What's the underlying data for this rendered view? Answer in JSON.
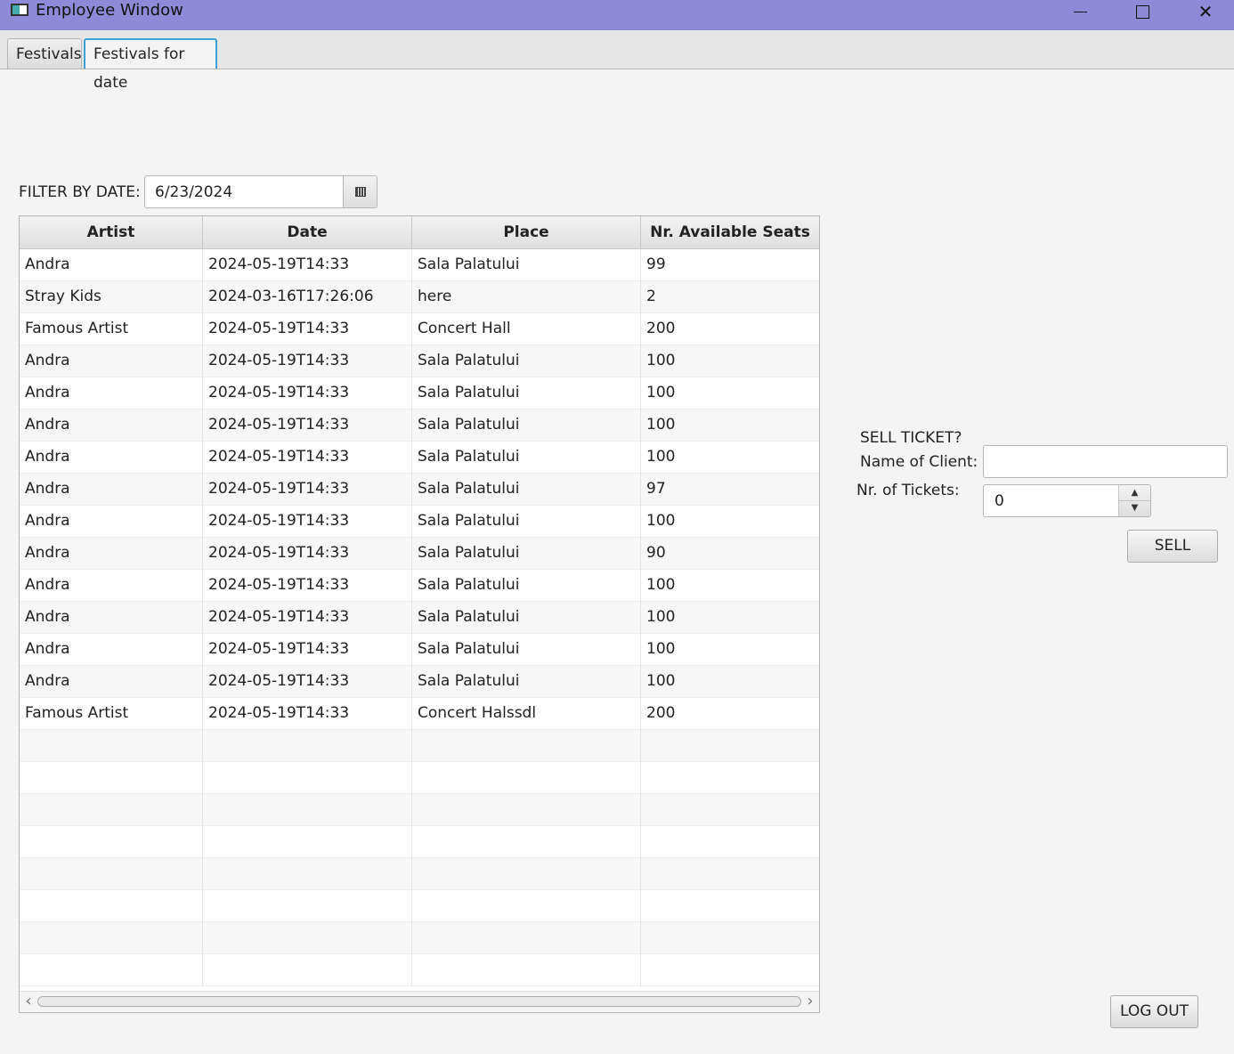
{
  "window": {
    "title": "Employee Window"
  },
  "tabs": [
    {
      "label": "Festivals"
    },
    {
      "label": "Festivals for date"
    }
  ],
  "filter": {
    "label": "FILTER BY DATE:",
    "date_value": "6/23/2024"
  },
  "table": {
    "headers": [
      "Artist",
      "Date",
      "Place",
      "Nr. Available Seats"
    ],
    "rows": [
      [
        "Andra",
        "2024-05-19T14:33",
        "Sala Palatului",
        "99"
      ],
      [
        "Stray Kids",
        "2024-03-16T17:26:06",
        "here",
        "2"
      ],
      [
        "Famous Artist",
        "2024-05-19T14:33",
        "Concert Hall",
        "200"
      ],
      [
        "Andra",
        "2024-05-19T14:33",
        "Sala Palatului",
        "100"
      ],
      [
        "Andra",
        "2024-05-19T14:33",
        "Sala Palatului",
        "100"
      ],
      [
        "Andra",
        "2024-05-19T14:33",
        "Sala Palatului",
        "100"
      ],
      [
        "Andra",
        "2024-05-19T14:33",
        "Sala Palatului",
        "100"
      ],
      [
        "Andra",
        "2024-05-19T14:33",
        "Sala Palatului",
        "97"
      ],
      [
        "Andra",
        "2024-05-19T14:33",
        "Sala Palatului",
        "100"
      ],
      [
        "Andra",
        "2024-05-19T14:33",
        "Sala Palatului",
        "90"
      ],
      [
        "Andra",
        "2024-05-19T14:33",
        "Sala Palatului",
        "100"
      ],
      [
        "Andra",
        "2024-05-19T14:33",
        "Sala Palatului",
        "100"
      ],
      [
        "Andra",
        "2024-05-19T14:33",
        "Sala Palatului",
        "100"
      ],
      [
        "Andra",
        "2024-05-19T14:33",
        "Sala Palatului",
        "100"
      ],
      [
        "Famous Artist",
        "2024-05-19T14:33",
        "Concert Halssdl",
        "200"
      ]
    ]
  },
  "sell": {
    "title": "SELL TICKET?",
    "client_label": "Name of Client:",
    "client_value": "",
    "tickets_label": "Nr. of Tickets:",
    "tickets_value": "0",
    "button_label": "SELL"
  },
  "logout": {
    "button_label": "LOG OUT"
  },
  "colors": {
    "titlebar": "#8f8ad8",
    "focus": "#3aa0d8"
  }
}
